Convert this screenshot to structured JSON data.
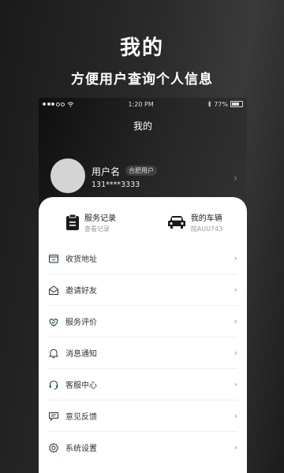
{
  "hero": {
    "title": "我的",
    "subtitle": "方便用户查询个人信息"
  },
  "status_bar": {
    "time": "1:20 PM",
    "battery": "77%"
  },
  "nav": {
    "title": "我的"
  },
  "profile": {
    "username": "用户名",
    "city_badge": "合肥用户",
    "phone": "131****3333",
    "chevron": "›"
  },
  "quick_actions": [
    {
      "title": "服务记录",
      "subtitle": "查看记录",
      "icon": "clipboard-icon"
    },
    {
      "title": "我的车辆",
      "subtitle": "皖AUU743",
      "icon": "car-icon"
    }
  ],
  "menu": [
    {
      "label": "收货地址",
      "icon": "address-icon"
    },
    {
      "label": "邀请好友",
      "icon": "invite-icon"
    },
    {
      "label": "服务评价",
      "icon": "review-icon"
    },
    {
      "label": "消息通知",
      "icon": "bell-icon"
    },
    {
      "label": "客服中心",
      "icon": "headset-icon"
    },
    {
      "label": "意见反馈",
      "icon": "feedback-icon"
    },
    {
      "label": "系统设置",
      "icon": "settings-icon"
    }
  ],
  "chevron": "›"
}
